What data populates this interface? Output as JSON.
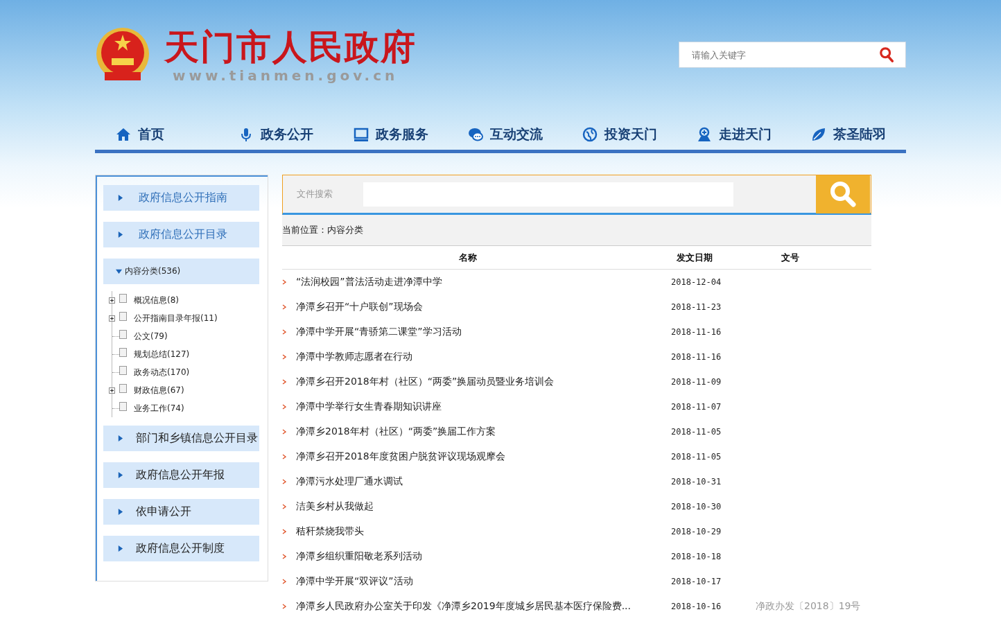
{
  "header": {
    "site_title": "天门市人民政府",
    "site_url": "www.tianmen.gov.cn",
    "search": {
      "placeholder": "请输入关键字"
    }
  },
  "nav": [
    {
      "label": "首页"
    },
    {
      "label": "政务公开"
    },
    {
      "label": "政务服务"
    },
    {
      "label": "互动交流"
    },
    {
      "label": "投资天门"
    },
    {
      "label": "走进天门"
    },
    {
      "label": "茶圣陆羽"
    }
  ],
  "sidebar": {
    "items": [
      {
        "label": "政府信息公开指南",
        "expanded": false,
        "highlighted": true
      },
      {
        "label": "政府信息公开目录",
        "expanded": false,
        "highlighted": true
      },
      {
        "label": "内容分类(536)",
        "expanded": true,
        "highlighted": false,
        "children": [
          {
            "label": "概况信息(8)",
            "kind": "expandable"
          },
          {
            "label": "公开指南目录年报(11)",
            "kind": "expandable"
          },
          {
            "label": "公文(79)",
            "kind": "leaf"
          },
          {
            "label": "规划总结(127)",
            "kind": "leaf"
          },
          {
            "label": "政务动态(170)",
            "kind": "leaf"
          },
          {
            "label": "财政信息(67)",
            "kind": "expandable"
          },
          {
            "label": "业务工作(74)",
            "kind": "leaf"
          }
        ]
      },
      {
        "label": "部门和乡镇信息公开目录",
        "expanded": false,
        "highlighted": false
      },
      {
        "label": "政府信息公开年报",
        "expanded": false,
        "highlighted": false
      },
      {
        "label": "依申请公开",
        "expanded": false,
        "highlighted": false
      },
      {
        "label": "政府信息公开制度",
        "expanded": false,
        "highlighted": false
      }
    ]
  },
  "file_search": {
    "label": "文件搜索"
  },
  "breadcrumb": "当前位置：内容分类",
  "table": {
    "columns": [
      "名称",
      "发文日期",
      "文号"
    ],
    "rows": [
      {
        "title": "“法润校园”普法活动走进净潭中学",
        "date": "2018-12-04"
      },
      {
        "title": "净潭乡召开“十户联创”现场会",
        "date": "2018-11-23"
      },
      {
        "title": "净潭中学开展“青骄第二课堂”学习活动",
        "date": "2018-11-16"
      },
      {
        "title": "净潭中学教师志愿者在行动",
        "date": "2018-11-16"
      },
      {
        "title": "净潭乡召开2018年村（社区）“两委”换届动员暨业务培训会",
        "date": "2018-11-09"
      },
      {
        "title": "净潭中学举行女生青春期知识讲座",
        "date": "2018-11-07"
      },
      {
        "title": "净潭乡2018年村（社区）“两委”换届工作方案",
        "date": "2018-11-05"
      },
      {
        "title": "净潭乡召开2018年度贫困户脱贫评议现场观摩会",
        "date": "2018-11-05"
      },
      {
        "title": "净潭污水处理厂通水调试",
        "date": "2018-10-31"
      },
      {
        "title": "洁美乡村从我做起",
        "date": "2018-10-30"
      },
      {
        "title": "秸秆禁烧我带头",
        "date": "2018-10-29"
      },
      {
        "title": "净潭乡组织重阳敬老系列活动",
        "date": "2018-10-18"
      },
      {
        "title": "净潭中学开展“双评议”活动",
        "date": "2018-10-17"
      },
      {
        "title": "净潭乡人民政府办公室关于印发《净潭乡2019年度城乡居民基本医疗保险费...",
        "date": "2018-10-16",
        "doc_no": "净政办发〔2018〕19号"
      }
    ]
  }
}
